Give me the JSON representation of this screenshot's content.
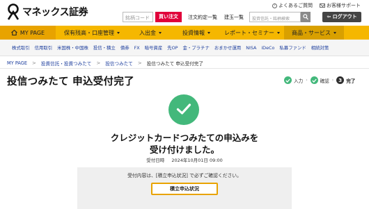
{
  "brand": {
    "name": "マネックス証券",
    "accent": "#f5b700",
    "danger": "#e0003a",
    "success": "#43b87b"
  },
  "header": {
    "faq": "よくあるご質問",
    "support": "お客様サポート",
    "code_placeholder": "銘柄コード",
    "buy_label": "買い注文",
    "order_link": "注文約定一覧",
    "position_link": "建玉一覧",
    "search_placeholder": "投資信託・銘柄検索",
    "logout_label": "ログアウト",
    "logout_icon": "logout-arrow-icon"
  },
  "mainnav": [
    {
      "label": "MY PAGE"
    },
    {
      "label": "保有残高・口座管理"
    },
    {
      "label": "入出金"
    },
    {
      "label": "投資情報"
    },
    {
      "label": "レポート・セミナー"
    },
    {
      "label": "商品・サービス"
    }
  ],
  "subnav": [
    "株式取引",
    "信用取引",
    "米国株・中国株",
    "投信・積立",
    "債券",
    "FX",
    "暗号資産",
    "先OP",
    "金・プラチナ",
    "おまかせ運用",
    "NISA",
    "iDeCo",
    "私募ファンド",
    "相続対策"
  ],
  "breadcrumb": [
    "MY PAGE",
    "投資信託・投資つみたて",
    "投信つみたて",
    "投信つみたて 申込受付完了"
  ],
  "page": {
    "title": "投信つみたて 申込受付完了",
    "steps": [
      {
        "label": "入力",
        "state": "done"
      },
      {
        "label": "確認",
        "state": "done"
      },
      {
        "number": "3",
        "label": "完了",
        "state": "current"
      }
    ],
    "message_line1": "クレジットカードつみたての申込みを",
    "message_line2": "受け付けました。",
    "receipt_label": "受付日時",
    "receipt_value": "2024年10月01日 09:00",
    "notice": "受付内容は、[積立申込状況] で必ずご確認ください。",
    "status_button": "積立申込状況"
  }
}
